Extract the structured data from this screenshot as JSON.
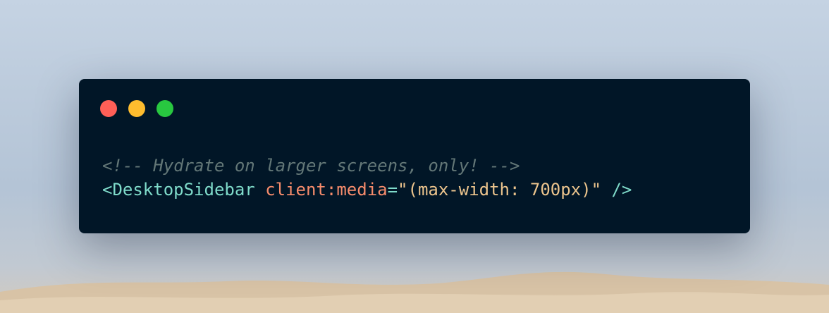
{
  "window": {
    "controls": [
      "close",
      "minimize",
      "maximize"
    ],
    "colors": {
      "background": "#011627",
      "close": "#ff5f57",
      "minimize": "#febc2e",
      "maximize": "#28c840"
    }
  },
  "code": {
    "comment": "<!-- Hydrate on larger screens, only! -->",
    "tag_open": "<DesktopSidebar",
    "attr_name": "client:media",
    "equals": "=",
    "attr_value": "\"(max-width: 700px)\"",
    "tag_close": "/>",
    "colors": {
      "comment": "#637777",
      "tag": "#7fdbca",
      "attribute": "#f78c6c",
      "string": "#ecc48d"
    }
  }
}
